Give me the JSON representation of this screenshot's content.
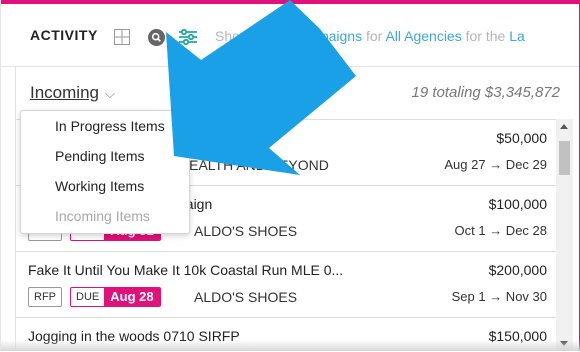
{
  "header": {
    "title": "ACTIVITY",
    "showing_prefix": "Showing ",
    "showing_campaigns": "All Campaigns",
    "showing_for": " for ",
    "showing_agencies": "All Agencies",
    "showing_tail": " for the ",
    "showing_cut": "La"
  },
  "toolbar": {
    "status_value": "Incoming",
    "totals": "19 totaling $3,345,872"
  },
  "dropdown": {
    "options": [
      "In Progress Items",
      "Pending Items",
      "Working Items",
      "Incoming Items"
    ],
    "selected": "Incoming Items"
  },
  "rows": [
    {
      "name": "",
      "amount": "$50,000",
      "agency": "HEALTH AND BEYOND",
      "dates": "Aug 27 → Dec 29",
      "badge_rfp": "",
      "due_label": "",
      "due_date": ""
    },
    {
      "name": "paign",
      "amount": "$100,000",
      "agency": "ALDO'S SHOES",
      "dates": "Oct 1 → Dec 28",
      "badge_rfp": "RFP",
      "due_label": "DUE",
      "due_date": "Aug 31"
    },
    {
      "name": "Fake It Until You Make It 10k Coastal Run MLE 0...",
      "amount": "$200,000",
      "agency": "ALDO'S SHOES",
      "dates": "Sep 1 → Nov 30",
      "badge_rfp": "RFP",
      "due_label": "DUE",
      "due_date": "Aug 28"
    },
    {
      "name": "Jogging in the woods 0710 SIRFP",
      "amount": "$150,000",
      "agency": "",
      "dates": "",
      "badge_rfp": "",
      "due_label": "",
      "due_date": ""
    }
  ],
  "colors": {
    "accent": "#e0117a",
    "link": "#3da7d6",
    "arrow": "#1aa0e6",
    "filter_icon": "#1fa7a0"
  },
  "icons": {
    "grid": "grid-icon",
    "search": "search-icon",
    "filter": "filter-sliders-icon",
    "chevron": "chevron-down-icon",
    "pointer": "annotation-arrow-icon"
  }
}
